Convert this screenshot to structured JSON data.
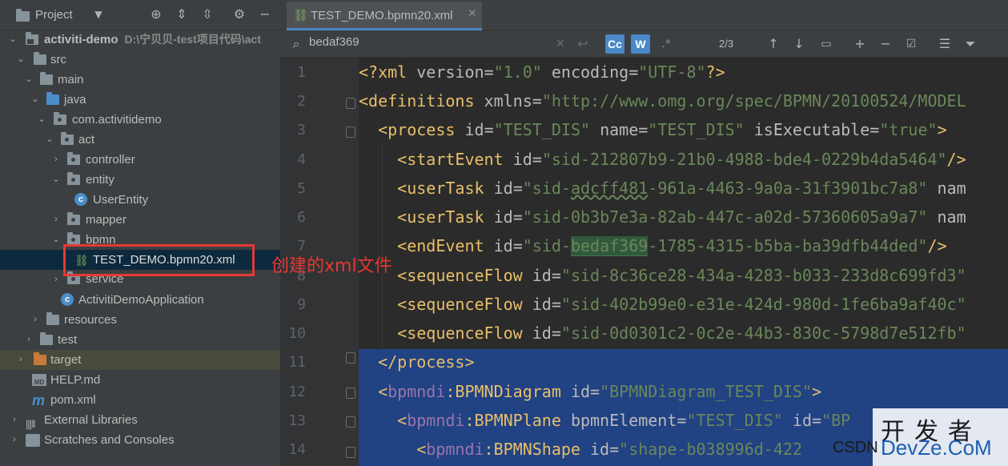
{
  "project_panel": {
    "title": "Project",
    "tree": [
      {
        "label": "activiti-demo",
        "path": "D:\\宁贝贝-test项目代码\\act"
      },
      {
        "label": "src"
      },
      {
        "label": "main"
      },
      {
        "label": "java"
      },
      {
        "label": "com.activitidemo"
      },
      {
        "label": "act"
      },
      {
        "label": "controller"
      },
      {
        "label": "entity"
      },
      {
        "label": "UserEntity"
      },
      {
        "label": "mapper"
      },
      {
        "label": "bpmn"
      },
      {
        "label": "TEST_DEMO.bpmn20.xml"
      },
      {
        "label": "service"
      },
      {
        "label": "ActivitiDemoApplication"
      },
      {
        "label": "resources"
      },
      {
        "label": "test"
      },
      {
        "label": "target"
      },
      {
        "label": "HELP.md"
      },
      {
        "label": "pom.xml"
      },
      {
        "label": "External Libraries"
      },
      {
        "label": "Scratches and Consoles"
      }
    ]
  },
  "annotation": {
    "text": "创建的xml文件",
    "color": "#e53935"
  },
  "editor_tab": {
    "title": "TEST_DEMO.bpmn20.xml"
  },
  "search": {
    "query": "bedaf369",
    "case_label": "Cc",
    "word_label": "W",
    "regex_label": ".*",
    "match_count": "2/3"
  },
  "editor": {
    "line_numbers": [
      "1",
      "2",
      "3",
      "4",
      "5",
      "6",
      "7",
      "8",
      "9",
      "10",
      "11",
      "12",
      "13",
      "14"
    ],
    "lines": [
      "<?xml version=\"1.0\" encoding=\"UTF-8\"?>",
      "<definitions xmlns=\"http://www.omg.org/spec/BPMN/20100524/MODEL",
      "  <process id=\"TEST_DIS\" name=\"TEST_DIS\" isExecutable=\"true\">",
      "    <startEvent id=\"sid-212807b9-21b0-4988-bde4-0229b4da5464\"/>",
      "    <userTask id=\"sid-adcff481-961a-4463-9a0a-31f3901bc7a8\" nam",
      "    <userTask id=\"sid-0b3b7e3a-82ab-447c-a02d-57360605a9a7\" nam",
      "    <endEvent id=\"sid-bedaf369-1785-4315-b5ba-ba39dfb44ded\"/>",
      "    <sequenceFlow id=\"sid-8c36ce28-434a-4283-b033-233d8c699fd3\"",
      "    <sequenceFlow id=\"sid-402b99e0-e31e-424d-980d-1fe6ba9af40c\"",
      "    <sequenceFlow id=\"sid-0d0301c2-0c2e-44b3-830c-5798d7e512fb\"",
      "  </process>",
      "  <bpmndi:BPMNDiagram id=\"BPMNDiagram_TEST_DIS\">",
      "    <bpmndi:BPMNPlane bpmnElement=\"TEST_DIS\" id=\"BP",
      "      <bpmndi:BPMNShape id=\"shape-b038996d-422"
    ]
  },
  "watermark": {
    "line1": "开发者",
    "csdn": "CSDN",
    "devze": "DevZe.CoM"
  },
  "colors": {
    "selection": "#214283",
    "search_highlight": "#32593d",
    "accent": "#4a88c7"
  }
}
